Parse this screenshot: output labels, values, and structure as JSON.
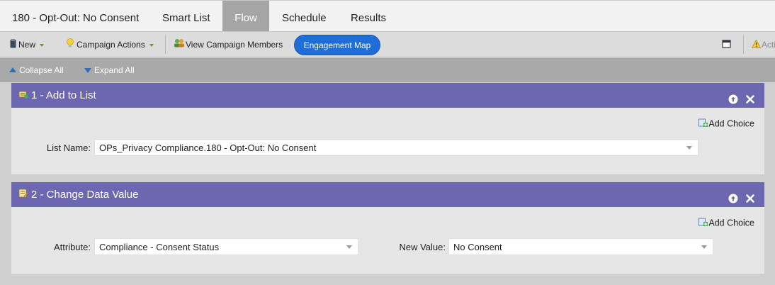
{
  "tabs": {
    "title": "180 - Opt-Out: No Consent",
    "items": [
      "Smart List",
      "Flow",
      "Schedule",
      "Results"
    ],
    "active": "Flow"
  },
  "toolbar": {
    "new_label": "New",
    "campaign_actions_label": "Campaign Actions",
    "view_members_label": "View Campaign Members",
    "engagement_map_label": "Engagement Map",
    "actions_truncated_label": "Acti"
  },
  "collapse_bar": {
    "collapse_all": "Collapse All",
    "expand_all": "Expand All"
  },
  "steps": [
    {
      "title": "1 - Add to List",
      "add_choice": "Add Choice",
      "fields": [
        {
          "label": "List Name:",
          "value": "OPs_Privacy Compliance.180 - Opt-Out: No Consent"
        }
      ]
    },
    {
      "title": "2 - Change Data Value",
      "add_choice": "Add Choice",
      "fields": [
        {
          "label": "Attribute:",
          "value": "Compliance - Consent Status"
        },
        {
          "label": "New Value:",
          "value": "No Consent"
        }
      ]
    }
  ],
  "colors": {
    "step_header": "#6d66b0",
    "active_tab": "#a5a5a5",
    "engagement_button": "#1f6ed8"
  }
}
